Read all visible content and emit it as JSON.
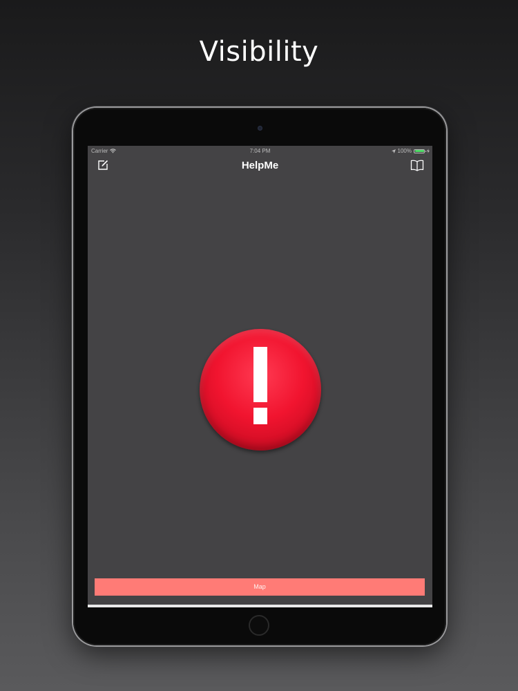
{
  "promo": {
    "title": "Visibility"
  },
  "status_bar": {
    "carrier": "Carrier",
    "time": "7:04 PM",
    "battery_percent": "100%",
    "battery_level": 1.0,
    "battery_color": "#4cd964"
  },
  "nav_bar": {
    "title": "HelpMe",
    "left_icon": "compose-icon",
    "right_icon": "book-icon"
  },
  "main": {
    "alert_icon": "exclamation-icon",
    "alert_color": "#f1142f",
    "map_button_label": "Map",
    "map_button_color": "#ff7b76"
  }
}
